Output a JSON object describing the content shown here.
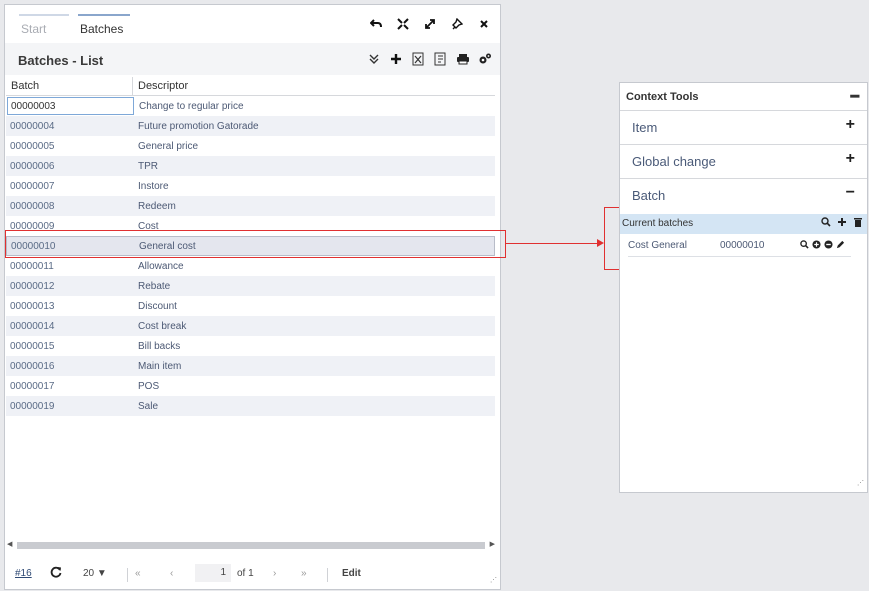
{
  "tabs": [
    {
      "label": "Start"
    },
    {
      "label": "Batches"
    }
  ],
  "list": {
    "title": "Batches - List",
    "columns": [
      "Batch",
      "Descriptor"
    ],
    "rows": [
      {
        "batch": "00000003",
        "descriptor": "Change to regular price"
      },
      {
        "batch": "00000004",
        "descriptor": "Future promotion Gatorade"
      },
      {
        "batch": "00000005",
        "descriptor": "General price"
      },
      {
        "batch": "00000006",
        "descriptor": "TPR"
      },
      {
        "batch": "00000007",
        "descriptor": "Instore"
      },
      {
        "batch": "00000008",
        "descriptor": "Redeem"
      },
      {
        "batch": "00000009",
        "descriptor": "Cost"
      },
      {
        "batch": "00000010",
        "descriptor": "General cost"
      },
      {
        "batch": "00000011",
        "descriptor": "Allowance"
      },
      {
        "batch": "00000012",
        "descriptor": "Rebate"
      },
      {
        "batch": "00000013",
        "descriptor": "Discount"
      },
      {
        "batch": "00000014",
        "descriptor": "Cost break"
      },
      {
        "batch": "00000015",
        "descriptor": "Bill backs"
      },
      {
        "batch": "00000016",
        "descriptor": "Main item"
      },
      {
        "batch": "00000017",
        "descriptor": "POS"
      },
      {
        "batch": "00000019",
        "descriptor": "Sale"
      }
    ]
  },
  "pager": {
    "id_link": "#16",
    "page_size": "20",
    "page": "1",
    "of": "of 1",
    "edit": "Edit"
  },
  "context_tools": {
    "title": "Context Tools",
    "sections": [
      {
        "label": "Item",
        "toggle": "+"
      },
      {
        "label": "Global change",
        "toggle": "+"
      },
      {
        "label": "Batch",
        "toggle": "−"
      }
    ],
    "current_batches": {
      "label": "Current batches",
      "row": {
        "name": "Cost General",
        "batch": "00000010"
      }
    }
  },
  "colors": {
    "accent": "#8aa6cc",
    "callout": "#e03030",
    "header_bar": "#d4e5f4"
  }
}
